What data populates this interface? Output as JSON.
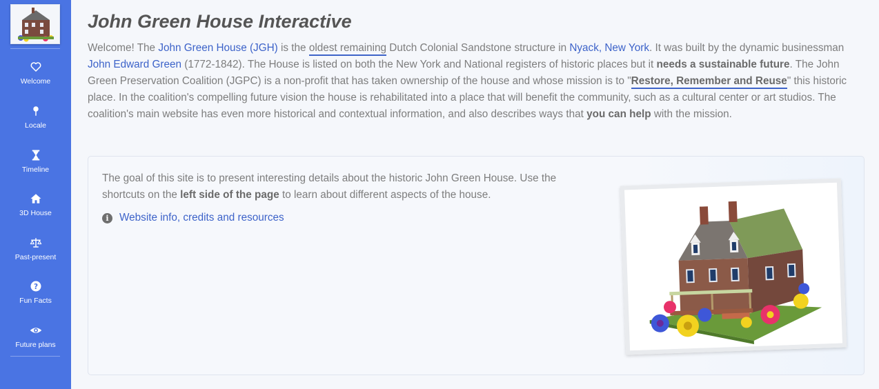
{
  "sidebar": {
    "items": [
      {
        "label": "Welcome",
        "icon": "heart-icon"
      },
      {
        "label": "Locale",
        "icon": "map-pin-icon"
      },
      {
        "label": "Timeline",
        "icon": "hourglass-icon"
      },
      {
        "label": "3D House",
        "icon": "home-icon"
      },
      {
        "label": "Past-present",
        "icon": "scale-icon"
      },
      {
        "label": "Fun Facts",
        "icon": "question-circle-icon"
      },
      {
        "label": "Future plans",
        "icon": "eye-icon"
      }
    ]
  },
  "header": {
    "title_regular": "John Green House",
    "title_bold": "Interactive"
  },
  "intro": {
    "t1": "Welcome! The ",
    "link_jgh": "John Green House (JGH)",
    "t2": " is the ",
    "oldest": "oldest remaining",
    "t3": " Dutch Colonial Sandstone structure in ",
    "link_nyack": "Nyack, New York",
    "t4": ". It was built by the dynamic businessman ",
    "link_john": "John Edward Green",
    "t5": " (1772-1842). The House is listed on both the New York and National registers of historic places but it ",
    "needs": "needs a sustainable future",
    "t6": ". The John Green Preservation Coalition (JGPC) is a non-profit that has taken ownership of the house and whose mission is to \"",
    "restore": "Restore, Remember and Reuse",
    "t7": "\" this historic place. In the coalition's compelling future vision the house is rehabilitated into a place that will benefit the community, such as a cultural center or art studios. The coalition's main website has even more historical and contextual information, and also describes ways that ",
    "help": "you can help",
    "t8": " with the mission."
  },
  "card": {
    "t1": "The goal of this site is to present interesting details about the historic John Green House. Use the shortcuts on the ",
    "bold": "left side of the page",
    "t2": " to learn about different aspects of the house.",
    "info_link": "Website info, credits and resources"
  },
  "colors": {
    "sidebar_bg": "#4a74e3",
    "link": "#3d63c9",
    "page_bg": "#f5f7fb"
  }
}
